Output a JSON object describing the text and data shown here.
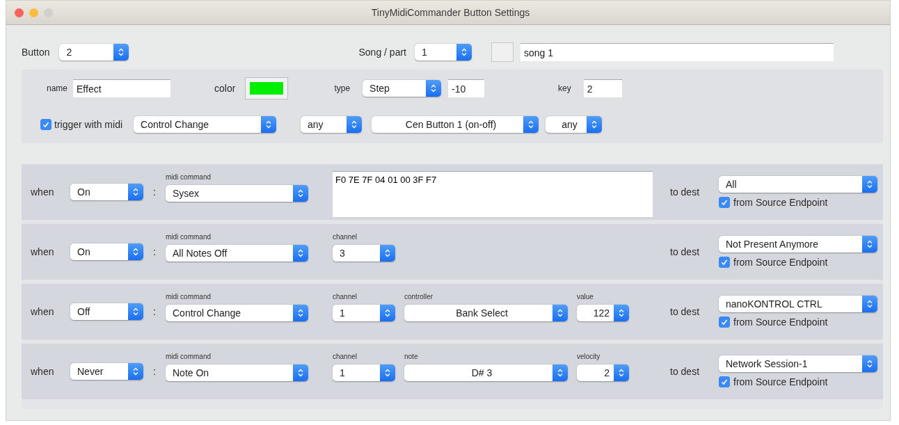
{
  "window": {
    "title": "TinyMidiCommander Button Settings"
  },
  "header": {
    "button_label": "Button",
    "button": "2",
    "song_part_label": "Song / part",
    "song_part": "1",
    "song_name": "song 1"
  },
  "button_settings": {
    "name_label": "name",
    "name": "Effect",
    "color_label": "color",
    "color": "#00ee00",
    "type_label": "type",
    "type": "Step",
    "type_value": "-10",
    "key_label": "key",
    "key": "2"
  },
  "trigger": {
    "checked": true,
    "label": "trigger with midi",
    "message": "Control Change",
    "channel": "any",
    "control": "Cen Button 1 (on-off)",
    "value": "any"
  },
  "actions": [
    {
      "when_label": "when",
      "when": "On",
      "separator": ":",
      "midi_command_label": "midi command",
      "midi_command": "Sysex",
      "kind": "sysex",
      "sysex": "F0 7E 7F 04 01 00 3F F7",
      "to_dest_label": "to dest",
      "dest": "All",
      "from_source": {
        "checked": true,
        "label": "from Source Endpoint"
      }
    },
    {
      "when_label": "when",
      "when": "On",
      "separator": ":",
      "midi_command_label": "midi command",
      "midi_command": "All Notes Off",
      "kind": "fields",
      "fields": [
        {
          "label": "channel",
          "value": "3",
          "kind": "narrow"
        }
      ],
      "to_dest_label": "to dest",
      "dest": "Not Present Anymore",
      "from_source": {
        "checked": true,
        "label": "from Source Endpoint"
      }
    },
    {
      "when_label": "when",
      "when": "Off",
      "separator": ":",
      "midi_command_label": "midi command",
      "midi_command": "Control Change",
      "kind": "fields",
      "fields": [
        {
          "label": "channel",
          "value": "1",
          "kind": "narrow"
        },
        {
          "label": "controller",
          "value": "Bank Select",
          "kind": "wide"
        },
        {
          "label": "value",
          "value": "122",
          "kind": "short"
        }
      ],
      "to_dest_label": "to dest",
      "dest": "nanoKONTROL CTRL",
      "from_source": {
        "checked": true,
        "label": "from Source Endpoint"
      }
    },
    {
      "when_label": "when",
      "when": "Never",
      "separator": ":",
      "midi_command_label": "midi command",
      "midi_command": "Note On",
      "kind": "fields",
      "fields": [
        {
          "label": "channel",
          "value": "1",
          "kind": "narrow"
        },
        {
          "label": "note",
          "value": "D# 3",
          "kind": "wide"
        },
        {
          "label": "velocity",
          "value": "2",
          "kind": "short"
        }
      ],
      "to_dest_label": "to dest",
      "dest": "Network Session-1",
      "from_source": {
        "checked": true,
        "label": "from Source Endpoint"
      }
    }
  ]
}
